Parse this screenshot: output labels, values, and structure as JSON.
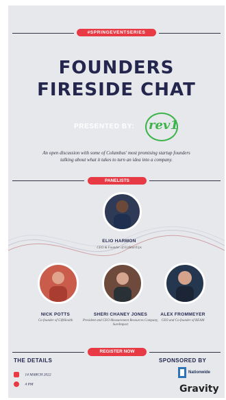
{
  "event": {
    "hashtag": "#SPRINGEVENTSERIES",
    "title_line_1": "FOUNDERS",
    "title_line_2": "FIRESIDE CHAT",
    "presented_by": "PRESENTED BY:",
    "presenter_logo": "rev1",
    "description": "An open discussion with some of Columbus' most promising startup founders talking about what it takes to turn an idea into a company."
  },
  "panelists_label": "PANELISTS",
  "panelists": [
    {
      "name": "ELIO HARMON",
      "role": "CEO & Founder of 614StartUps",
      "avatar_color": "#2f3a57"
    },
    {
      "name": "NICK POTTS",
      "role": "Co-founder of GiftHealth",
      "avatar_color": "#c95c4a"
    },
    {
      "name": "SHERI CHANEY JONES",
      "role": "President and CEO Measurement Resources Company, SureImpact",
      "avatar_color": "#6e4a3d"
    },
    {
      "name": "ALEX FROMMEYER",
      "role": "CEO and Co-founder of BEAM",
      "avatar_color": "#25374f"
    }
  ],
  "register": {
    "label": "REGISTER NOW"
  },
  "details": {
    "title": "THE DETAILS",
    "date": "14 MARCH 2022",
    "time": "4 PM"
  },
  "sponsors": {
    "title": "SPONSORED BY",
    "nationwide": "Nationwide",
    "gravity": "Gravity"
  },
  "colors": {
    "accent": "#e83a44",
    "navy": "#24264d",
    "background": "#e6e8eb",
    "rev1_green": "#3bb34a"
  }
}
